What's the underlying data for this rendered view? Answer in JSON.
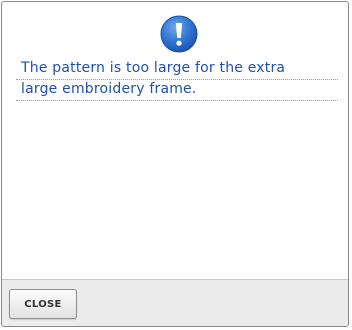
{
  "dialog": {
    "icon": "exclamation-icon",
    "accent_color": "#2a6fcf",
    "message_lines": [
      "The pattern is too large for the extra",
      "large embroidery frame."
    ],
    "close_label": "CLOSE"
  }
}
